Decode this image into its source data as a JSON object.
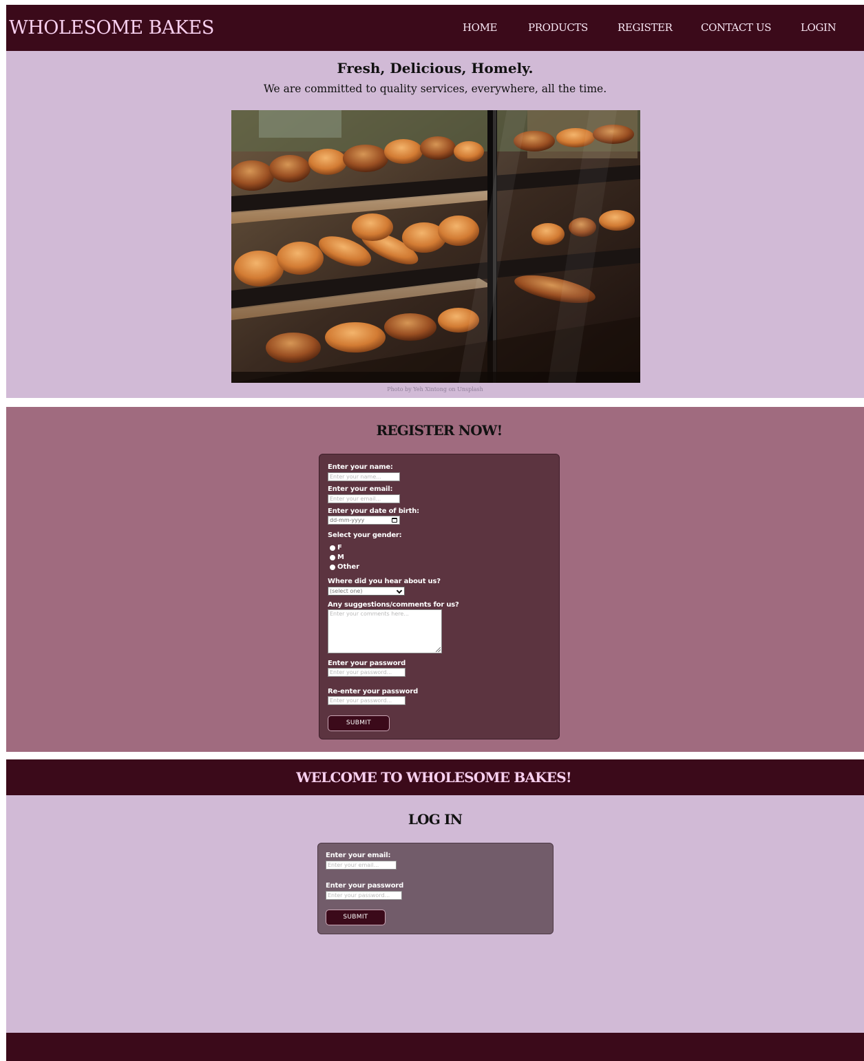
{
  "brand": "WHOLESOME BAKES",
  "nav": {
    "home": "HOME",
    "products": "PRODUCTS",
    "register": "REGISTER",
    "contact": "CONTACT US",
    "login": "LOGIN"
  },
  "hero": {
    "headline": "Fresh, Delicious, Homely.",
    "tagline": "We are committed to quality services, everywhere, all the time.",
    "photo_credit": "Photo by Yeh Xintong on Unsplash"
  },
  "register": {
    "title": "REGISTER NOW!",
    "name_label": "Enter your name:",
    "name_placeholder": "Enter your name...",
    "email_label": "Enter your email:",
    "email_placeholder": "Enter your email...",
    "dob_label": "Enter your date of birth:",
    "dob_placeholder": "dd-mm-yyyy",
    "gender_label": "Select your gender:",
    "gender_options": [
      "F",
      "M",
      "Other"
    ],
    "source_label": "Where did you hear about us?",
    "source_selected": "(select one)",
    "comments_label": "Any suggestions/comments for us?",
    "comments_placeholder": "Enter your comments here...",
    "password_label": "Enter your password",
    "password_placeholder": "Enter your password...",
    "repassword_label": "Re-enter your password",
    "repassword_placeholder": "Enter your password...",
    "submit": "SUBMIT"
  },
  "welcome": "WELCOME TO WHOLESOME BAKES!",
  "login": {
    "title": "LOG IN",
    "email_label": "Enter your email:",
    "email_placeholder": "Enter your email...",
    "password_label": "Enter your password",
    "password_placeholder": "Enter your password...",
    "submit": "SUBMIT"
  },
  "colors": {
    "nav_bg": "#3b0a1a",
    "hero_bg": "#d1bad6",
    "register_bg": "#a06b7f",
    "register_card": "#5c3440",
    "login_card": "#725c6a",
    "brand_text": "#f7cfee"
  }
}
